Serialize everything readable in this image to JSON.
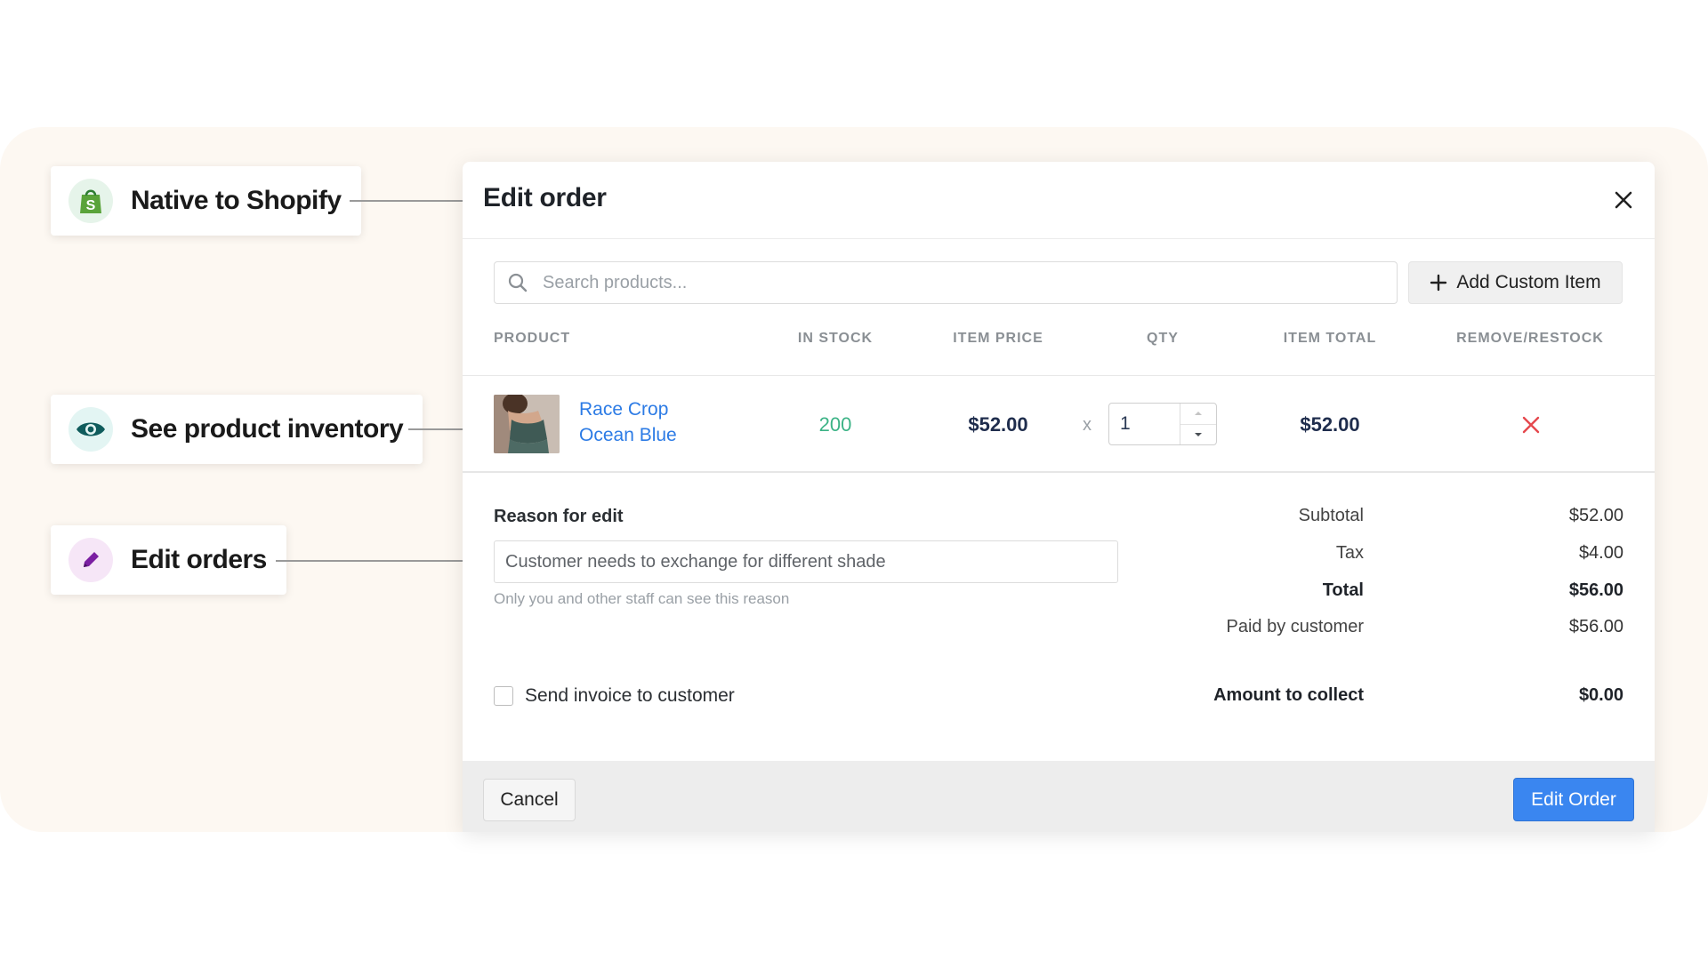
{
  "features": [
    {
      "label": "Native to Shopify",
      "icon": "shopify-bag-icon",
      "color": "#95bf47"
    },
    {
      "label": "See product inventory",
      "icon": "eye-icon",
      "color": "#0f5c5c"
    },
    {
      "label": "Edit orders",
      "icon": "pencil-icon",
      "color": "#7b1fa2"
    }
  ],
  "modal": {
    "title": "Edit order",
    "search_placeholder": "Search products...",
    "add_custom_item_label": "Add Custom Item",
    "columns": [
      "PRODUCT",
      "IN STOCK",
      "ITEM PRICE",
      "QTY",
      "ITEM TOTAL",
      "REMOVE/RESTOCK"
    ],
    "line_item": {
      "name_line1": "Race Crop",
      "name_line2": "Ocean Blue",
      "in_stock": "200",
      "item_price": "$52.00",
      "times": "x",
      "qty": "1",
      "item_total": "$52.00"
    },
    "reason_label": "Reason for edit",
    "reason_value": "Customer needs to exchange for different shade",
    "reason_help": "Only you and other staff can see this reason",
    "summary": {
      "subtotal_label": "Subtotal",
      "subtotal": "$52.00",
      "tax_label": "Tax",
      "tax": "$4.00",
      "total_label": "Total",
      "total": "$56.00",
      "paid_label": "Paid by customer",
      "paid": "$56.00",
      "collect_label": "Amount to collect",
      "collect": "$0.00"
    },
    "send_invoice_label": "Send invoice to customer",
    "cancel_label": "Cancel",
    "edit_order_label": "Edit Order"
  },
  "colors": {
    "accent": "#3a86f0",
    "link": "#2c7be5",
    "stock_green": "#3cb386",
    "remove_red": "#e5484d",
    "backdrop": "#fdf8f2"
  }
}
